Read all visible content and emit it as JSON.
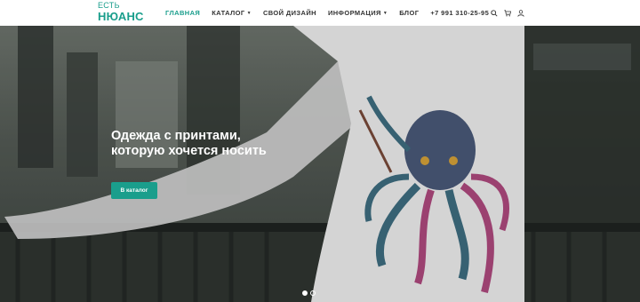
{
  "logo": {
    "line1": "ЕСТЬ",
    "line2": "НЮАНС"
  },
  "nav": [
    {
      "label": "ГЛАВНАЯ",
      "active": true,
      "dropdown": false
    },
    {
      "label": "КАТАЛОГ",
      "active": false,
      "dropdown": true
    },
    {
      "label": "СВОЙ ДИЗАЙН",
      "active": false,
      "dropdown": false
    },
    {
      "label": "ИНФОРМАЦИЯ",
      "active": false,
      "dropdown": true
    },
    {
      "label": "БЛОГ",
      "active": false,
      "dropdown": false
    },
    {
      "label": "+7 991 310-25-95",
      "active": false,
      "dropdown": false
    }
  ],
  "icons": [
    "search-icon",
    "cart-icon",
    "user-icon"
  ],
  "hero": {
    "title": "Одежда с принтами, которую хочется носить",
    "button_label": "В каталог",
    "slides_count": 2,
    "active_slide": 1
  },
  "colors": {
    "accent": "#1a9e8c"
  }
}
